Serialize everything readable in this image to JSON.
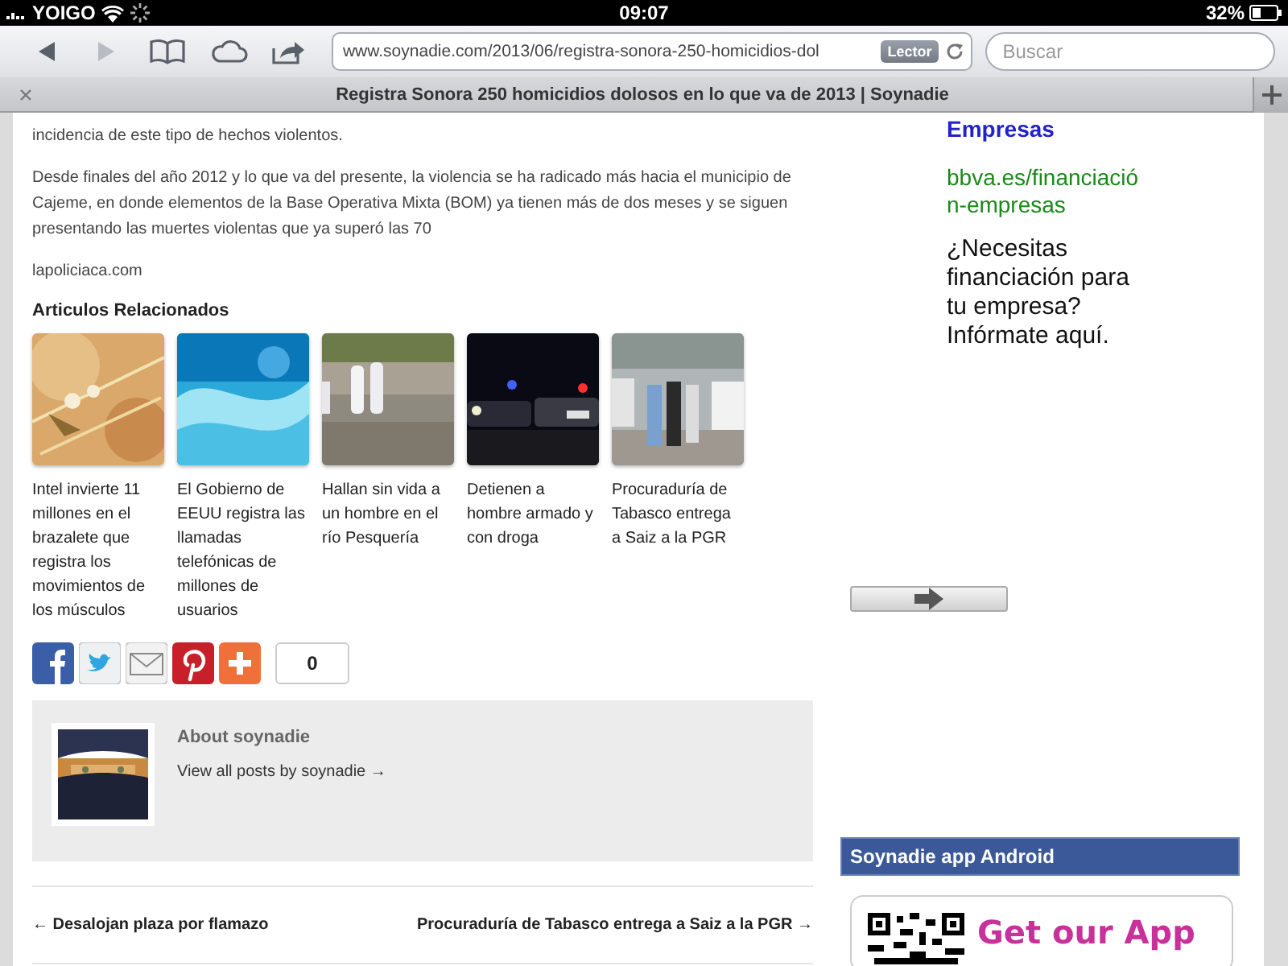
{
  "status_bar": {
    "carrier": "YOIGO",
    "time": "09:07",
    "battery": "32%"
  },
  "toolbar": {
    "buttons": [
      {
        "kind": "back",
        "disabled": false
      },
      {
        "kind": "forward",
        "disabled": true
      },
      {
        "kind": "bookmarks",
        "disabled": false
      },
      {
        "kind": "cloud",
        "disabled": false
      },
      {
        "kind": "share",
        "disabled": false
      }
    ],
    "url": "www.soynadie.com/2013/06/registra-sonora-250-homicidios-dol",
    "reader_button": "Lector",
    "search": {
      "placeholder": "Buscar"
    }
  },
  "tab": {
    "title": "Registra Sonora 250 homicidios dolosos en lo que va de 2013 | Soynadie"
  },
  "article": {
    "paragraphs": [
      "incidencia de este tipo de hechos violentos.",
      "Desde finales del año 2012 y lo que va del presente, la violencia se ha radicado más hacia el municipio de Cajeme, en donde elementos de la Base Operativa Mixta (BOM) ya tienen más de dos meses y se siguen presentando las muertes violentas que ya superó las 70",
      "lapoliciaca.com"
    ],
    "related_heading": "Articulos Relacionados",
    "related": [
      {
        "title": "Intel invierte 11 millones en el brazalete que registra los movimientos de los músculos",
        "kind": "picture"
      },
      {
        "title": "El Gobierno de EEUU registra las llamadas telefónicas de millones de usuarios",
        "kind": "picture"
      },
      {
        "title": "Hallan sin vida a un hombre en el río Pesquería",
        "kind": "picture"
      },
      {
        "title": "Detienen a hombre armado y con droga",
        "kind": "picture"
      },
      {
        "title": "Procuraduría de Tabasco entrega a Saiz a la PGR",
        "kind": "picture"
      }
    ],
    "share": [
      {
        "kind": "facebook"
      },
      {
        "kind": "twitter"
      },
      {
        "kind": "email"
      },
      {
        "kind": "pinterest"
      },
      {
        "kind": "more"
      }
    ],
    "share_count": "0",
    "author": {
      "heading": "About soynadie",
      "link": "View all posts by soynadie →"
    },
    "nav": {
      "previous": "← Desalojan plaza por flamazo",
      "next": "Procuraduría de Tabasco entrega a Saiz a la PGR →"
    }
  },
  "sidebar": {
    "ad": {
      "title": "Empresas",
      "url": "bbva.es/financiación-empresas",
      "text": "¿Necesitas financiación para tu empresa? Infórmate aquí."
    },
    "widget_title": "Soynadie app Android",
    "app_banner": "Get our App"
  }
}
